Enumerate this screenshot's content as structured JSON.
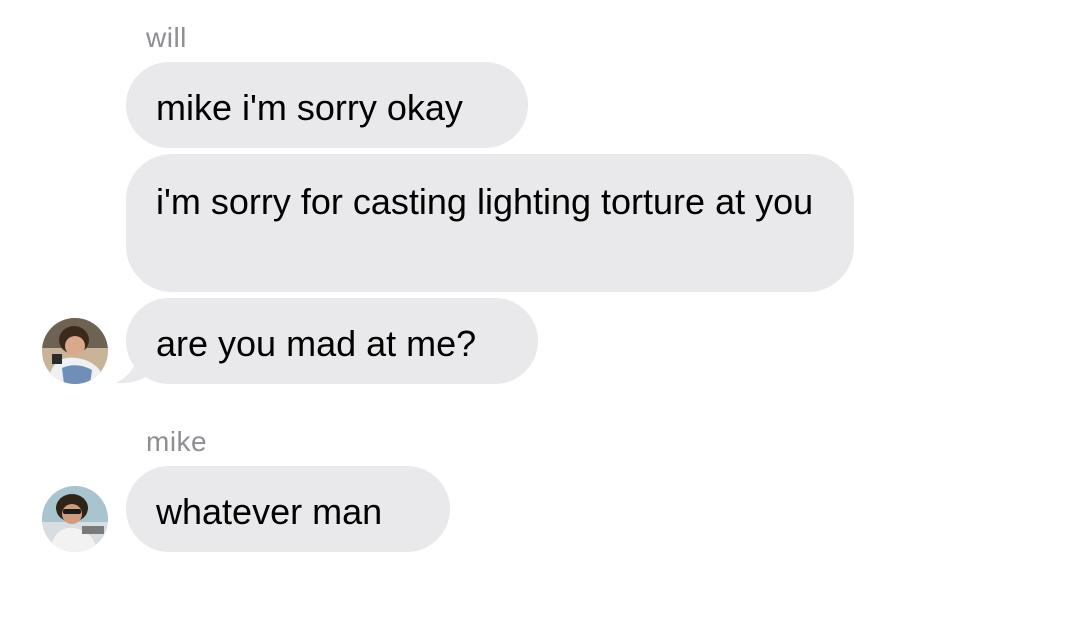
{
  "conversation": {
    "groups": [
      {
        "sender": "will",
        "messages": [
          "mike i'm sorry okay",
          "i'm sorry for casting lighting torture at you",
          "are you mad at me?"
        ],
        "avatar": "will-avatar-photo"
      },
      {
        "sender": "mike",
        "messages": [
          "whatever man"
        ],
        "avatar": "mike-avatar-photo"
      }
    ]
  },
  "colors": {
    "background": "#ffffff",
    "incoming_bubble": "#e9e9eb",
    "sender_label": "#8e8e93",
    "text": "#000000"
  }
}
